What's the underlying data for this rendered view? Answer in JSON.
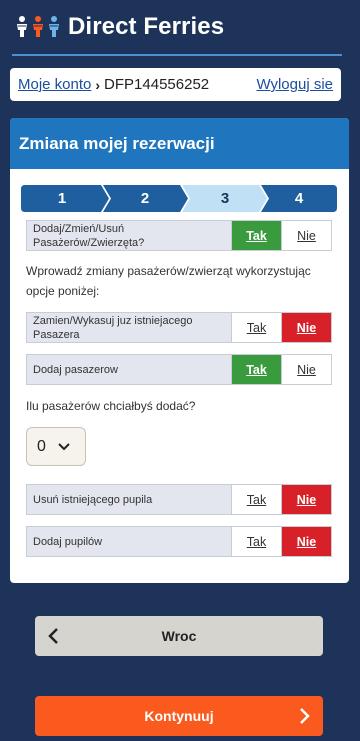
{
  "header": {
    "brand": "Direct Ferries"
  },
  "account_bar": {
    "account_link": "Moje konto",
    "separator": "›",
    "booking_ref": "DFP144556252",
    "logout": "Wyloguj sie"
  },
  "card": {
    "title": "Zmiana mojej rezerwacji",
    "steps": [
      "1",
      "2",
      "3",
      "4"
    ],
    "active_step": "3",
    "question_add_change": {
      "label": "Dodaj/Zmień/Usuń Pasażerów/Zwierzęta?",
      "yes": "Tak",
      "no": "Nie",
      "selected": "Tak"
    },
    "instruction": "Wprowadź zmiany pasażerów/zwierząt wykorzystując opcje poniżej:",
    "replace_passenger": {
      "label": "Zamien/Wykasuj juz istniejacego Pasazera",
      "yes": "Tak",
      "no": "Nie",
      "selected": "Nie"
    },
    "add_passenger": {
      "label": "Dodaj pasazerow",
      "yes": "Tak",
      "no": "Nie",
      "selected": "Tak"
    },
    "how_many_question": "Ilu pasażerów chciałbyś dodać?",
    "passenger_count": "0",
    "remove_pet": {
      "label": "Usuń istniejącego pupila",
      "yes": "Tak",
      "no": "Nie",
      "selected": "Nie"
    },
    "add_pet": {
      "label": "Dodaj pupilów",
      "yes": "Tak",
      "no": "Nie",
      "selected": "Nie"
    }
  },
  "buttons": {
    "back": "Wroc",
    "continue": "Kontynuuj"
  },
  "colors": {
    "background": "#1e3359",
    "card_header": "#1f75be",
    "step_done": "#1f5f9f",
    "step_active": "#bfe0f5",
    "selected_green": "#3a9b3e",
    "selected_red": "#d72027",
    "continue": "#fa5a1e"
  }
}
